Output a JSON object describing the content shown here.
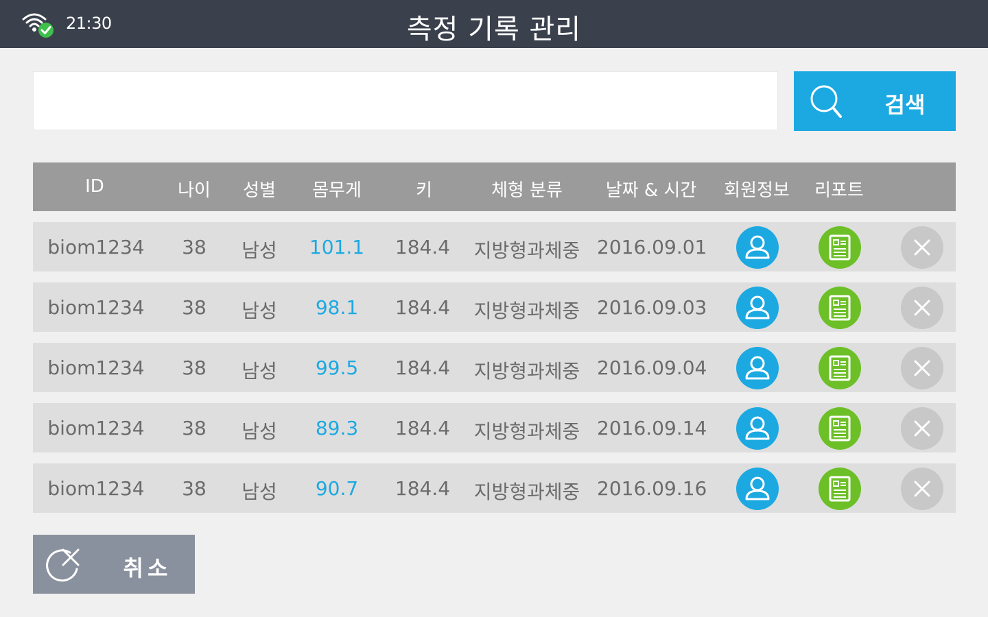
{
  "status_bar": {
    "time": "21:30",
    "wifi_icon": "wifi-connected-icon"
  },
  "header": {
    "title": "측정 기록 관리"
  },
  "search": {
    "placeholder": "",
    "value": "",
    "button_label": "검색",
    "button_icon": "search-icon"
  },
  "table": {
    "columns": [
      "ID",
      "나이",
      "성별",
      "몸무게",
      "키",
      "체형 분류",
      "날짜 & 시간",
      "회원정보",
      "리포트"
    ],
    "rows": [
      {
        "id": "biom1234",
        "age": "38",
        "gender": "남성",
        "weight": "101.1",
        "height": "184.4",
        "body_type": "지방형과체중",
        "date": "2016.09.01"
      },
      {
        "id": "biom1234",
        "age": "38",
        "gender": "남성",
        "weight": "98.1",
        "height": "184.4",
        "body_type": "지방형과체중",
        "date": "2016.09.03"
      },
      {
        "id": "biom1234",
        "age": "38",
        "gender": "남성",
        "weight": "99.5",
        "height": "184.4",
        "body_type": "지방형과체중",
        "date": "2016.09.04"
      },
      {
        "id": "biom1234",
        "age": "38",
        "gender": "남성",
        "weight": "89.3",
        "height": "184.4",
        "body_type": "지방형과체중",
        "date": "2016.09.14"
      },
      {
        "id": "biom1234",
        "age": "38",
        "gender": "남성",
        "weight": "90.7",
        "height": "184.4",
        "body_type": "지방형과체중",
        "date": "2016.09.16"
      }
    ],
    "row_icons": {
      "member": "user-icon",
      "report": "report-icon",
      "delete": "close-icon"
    }
  },
  "footer": {
    "cancel_label": "취소",
    "cancel_icon": "cancel-icon"
  },
  "colors": {
    "topbar": "#3a404c",
    "accent_blue": "#1ca9e1",
    "accent_green": "#6dbf27",
    "header_gray": "#9b9b9b",
    "row_gray": "#dedede",
    "cancel_gray": "#8a919e"
  }
}
